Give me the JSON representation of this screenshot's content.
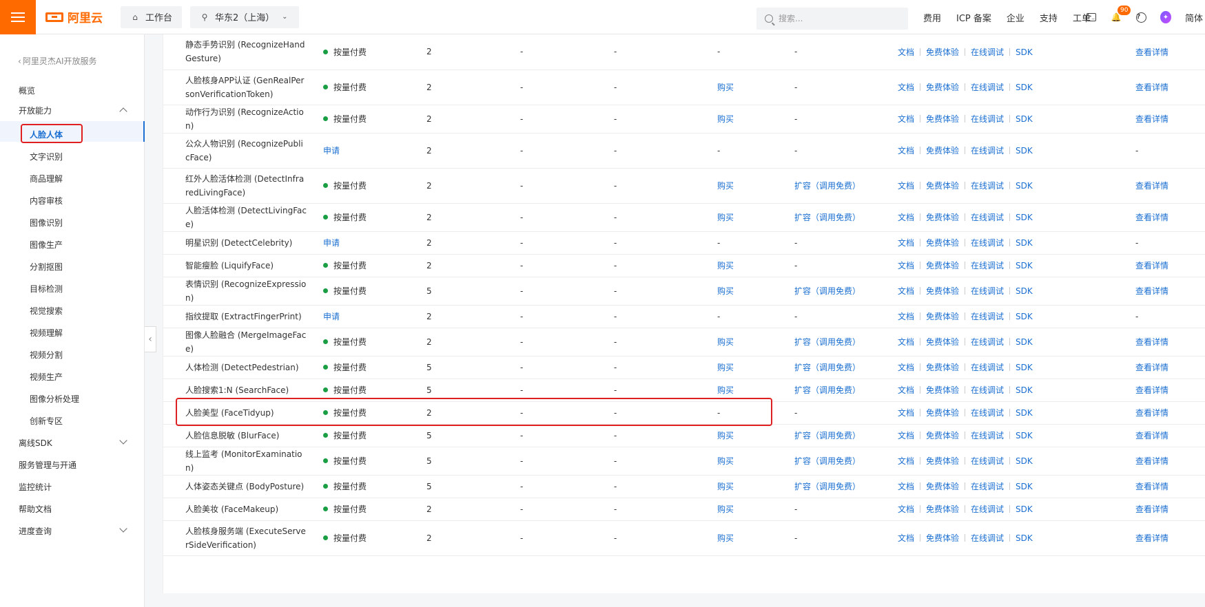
{
  "topbar": {
    "brand": "阿里云",
    "workbench": "工作台",
    "region": "华东2（上海）",
    "search_placeholder": "搜索...",
    "links": [
      "费用",
      "ICP 备案",
      "企业",
      "支持",
      "工单"
    ],
    "notification_count": "90",
    "language": "简体"
  },
  "sidebar": {
    "back_label": "阿里灵杰AI开放服务",
    "overview": "概览",
    "open_capability": "开放能力",
    "active": "人脸人体",
    "sub_items": [
      "文字识别",
      "商品理解",
      "内容审核",
      "图像识别",
      "图像生产",
      "分割抠图",
      "目标检测",
      "视觉搜索",
      "视频理解",
      "视频分割",
      "视频生产",
      "图像分析处理",
      "创新专区"
    ],
    "offline_sdk": "离线SDK",
    "service_mgmt": "服务管理与开通",
    "monitoring": "监控统计",
    "help_docs": "帮助文档",
    "progress": "进度查询"
  },
  "table": {
    "action_labels": {
      "doc": "文档",
      "trial": "免费体验",
      "debug": "在线调试",
      "sdk": "SDK"
    },
    "rows": [
      {
        "name": "静态手势识别 (RecognizeHandGesture)",
        "billing": "按量付费",
        "qps": "2",
        "a": "-",
        "b": "-",
        "buy": "-",
        "expand": "-",
        "detail": "查看详情",
        "tall": true,
        "applied": false
      },
      {
        "name": "人脸核身APP认证 (GenRealPersonVerificationToken)",
        "billing": "按量付费",
        "qps": "2",
        "a": "-",
        "b": "-",
        "buy": "购买",
        "expand": "-",
        "detail": "查看详情",
        "tall": true,
        "applied": false
      },
      {
        "name": "动作行为识别 (RecognizeAction)",
        "billing": "按量付费",
        "qps": "2",
        "a": "-",
        "b": "-",
        "buy": "购买",
        "expand": "-",
        "detail": "查看详情",
        "tall": false,
        "applied": false
      },
      {
        "name": "公众人物识别 (RecognizePublicFace)",
        "billing": "申请",
        "qps": "2",
        "a": "-",
        "b": "-",
        "buy": "-",
        "expand": "-",
        "detail": "-",
        "tall": true,
        "applied": true
      },
      {
        "name": "红外人脸活体检测 (DetectInfraredLivingFace)",
        "billing": "按量付费",
        "qps": "2",
        "a": "-",
        "b": "-",
        "buy": "购买",
        "expand": "扩容（调用免费）",
        "detail": "查看详情",
        "tall": true,
        "applied": false
      },
      {
        "name": "人脸活体检测 (DetectLivingFace)",
        "billing": "按量付费",
        "qps": "2",
        "a": "-",
        "b": "-",
        "buy": "购买",
        "expand": "扩容（调用免费）",
        "detail": "查看详情",
        "tall": false,
        "applied": false
      },
      {
        "name": "明星识别 (DetectCelebrity)",
        "billing": "申请",
        "qps": "2",
        "a": "-",
        "b": "-",
        "buy": "-",
        "expand": "-",
        "detail": "-",
        "tall": false,
        "applied": true
      },
      {
        "name": "智能瘦脸 (LiquifyFace)",
        "billing": "按量付费",
        "qps": "2",
        "a": "-",
        "b": "-",
        "buy": "购买",
        "expand": "-",
        "detail": "查看详情",
        "tall": false,
        "applied": false
      },
      {
        "name": "表情识别 (RecognizeExpression)",
        "billing": "按量付费",
        "qps": "5",
        "a": "-",
        "b": "-",
        "buy": "购买",
        "expand": "扩容（调用免费）",
        "detail": "查看详情",
        "tall": false,
        "applied": false
      },
      {
        "name": "指纹提取 (ExtractFingerPrint)",
        "billing": "申请",
        "qps": "2",
        "a": "-",
        "b": "-",
        "buy": "-",
        "expand": "-",
        "detail": "-",
        "tall": false,
        "applied": true
      },
      {
        "name": "图像人脸融合 (MergeImageFace)",
        "billing": "按量付费",
        "qps": "2",
        "a": "-",
        "b": "-",
        "buy": "购买",
        "expand": "扩容（调用免费）",
        "detail": "查看详情",
        "tall": false,
        "applied": false
      },
      {
        "name": "人体检测 (DetectPedestrian)",
        "billing": "按量付费",
        "qps": "5",
        "a": "-",
        "b": "-",
        "buy": "购买",
        "expand": "扩容（调用免费）",
        "detail": "查看详情",
        "tall": false,
        "applied": false
      },
      {
        "name": "人脸搜索1:N (SearchFace)",
        "billing": "按量付费",
        "qps": "5",
        "a": "-",
        "b": "-",
        "buy": "购买",
        "expand": "扩容（调用免费）",
        "detail": "查看详情",
        "tall": false,
        "applied": false
      },
      {
        "name": "人脸美型 (FaceTidyup)",
        "billing": "按量付费",
        "qps": "2",
        "a": "-",
        "b": "-",
        "buy": "-",
        "expand": "-",
        "detail": "查看详情",
        "tall": false,
        "applied": false
      },
      {
        "name": "人脸信息脱敏 (BlurFace)",
        "billing": "按量付费",
        "qps": "5",
        "a": "-",
        "b": "-",
        "buy": "购买",
        "expand": "扩容（调用免费）",
        "detail": "查看详情",
        "tall": false,
        "applied": false
      },
      {
        "name": "线上监考 (MonitorExamination)",
        "billing": "按量付费",
        "qps": "5",
        "a": "-",
        "b": "-",
        "buy": "购买",
        "expand": "扩容（调用免费）",
        "detail": "查看详情",
        "tall": false,
        "applied": false
      },
      {
        "name": "人体姿态关键点 (BodyPosture)",
        "billing": "按量付费",
        "qps": "5",
        "a": "-",
        "b": "-",
        "buy": "购买",
        "expand": "扩容（调用免费）",
        "detail": "查看详情",
        "tall": false,
        "applied": false
      },
      {
        "name": "人脸美妆 (FaceMakeup)",
        "billing": "按量付费",
        "qps": "2",
        "a": "-",
        "b": "-",
        "buy": "购买",
        "expand": "-",
        "detail": "查看详情",
        "tall": false,
        "applied": false
      },
      {
        "name": "人脸核身服务端 (ExecuteServerSideVerification)",
        "billing": "按量付费",
        "qps": "2",
        "a": "-",
        "b": "-",
        "buy": "购买",
        "expand": "-",
        "detail": "查看详情",
        "tall": true,
        "applied": false
      }
    ]
  }
}
